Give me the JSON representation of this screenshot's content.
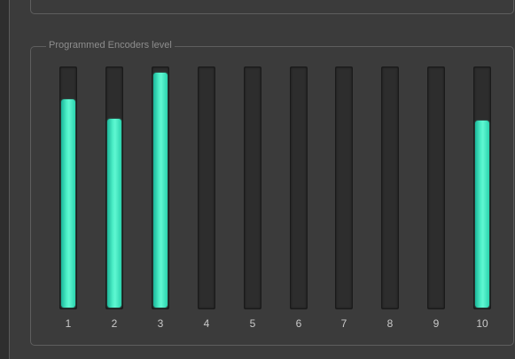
{
  "panel": {
    "title": "Programmed Encoders level"
  },
  "colors": {
    "background": "#3b3b3b",
    "accent": "#4ef0c8",
    "track": "#2d2d2d",
    "label": "#c9c9c9"
  },
  "encoders": [
    {
      "label": "1",
      "level": 0.87
    },
    {
      "label": "2",
      "level": 0.79
    },
    {
      "label": "3",
      "level": 0.98
    },
    {
      "label": "4",
      "level": 0
    },
    {
      "label": "5",
      "level": 0
    },
    {
      "label": "6",
      "level": 0
    },
    {
      "label": "7",
      "level": 0
    },
    {
      "label": "8",
      "level": 0
    },
    {
      "label": "9",
      "level": 0
    },
    {
      "label": "10",
      "level": 0.78
    }
  ]
}
